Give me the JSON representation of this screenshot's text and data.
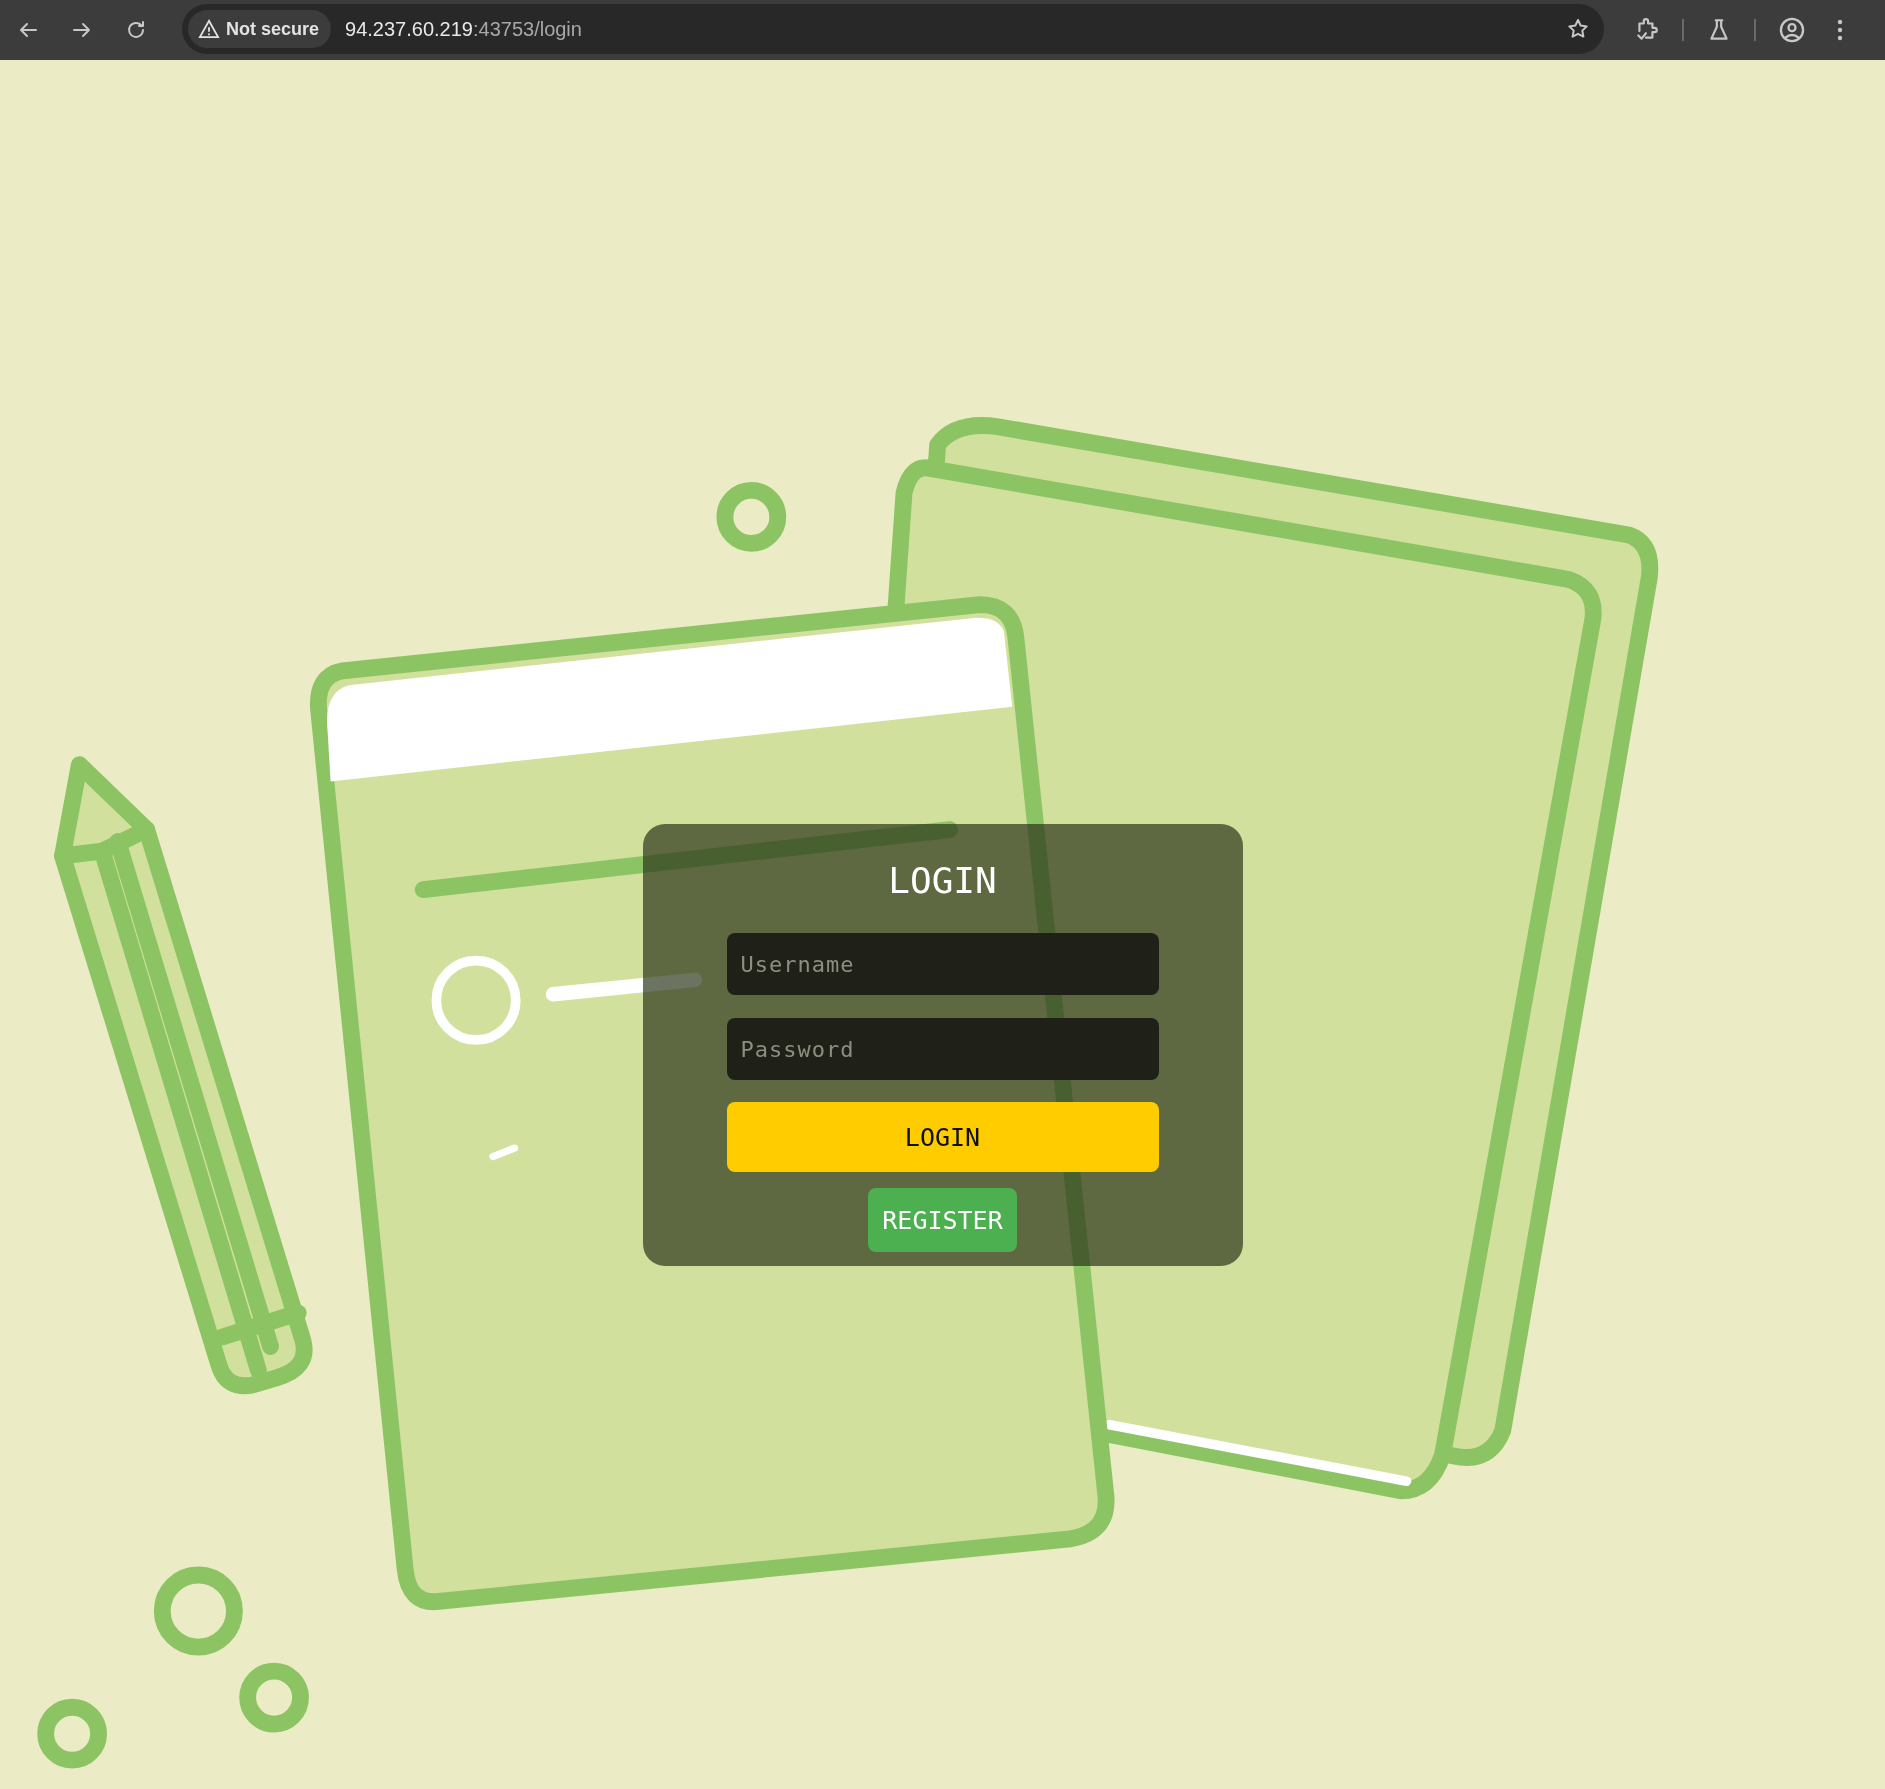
{
  "browser": {
    "security_chip": "Not secure",
    "url_host": "94.237.60.219",
    "url_path": ":43753/login"
  },
  "login_form": {
    "title": "LOGIN",
    "username": {
      "placeholder": "Username"
    },
    "password": {
      "placeholder": "Password"
    },
    "login_button": "LOGIN",
    "register_button": "REGISTER"
  }
}
